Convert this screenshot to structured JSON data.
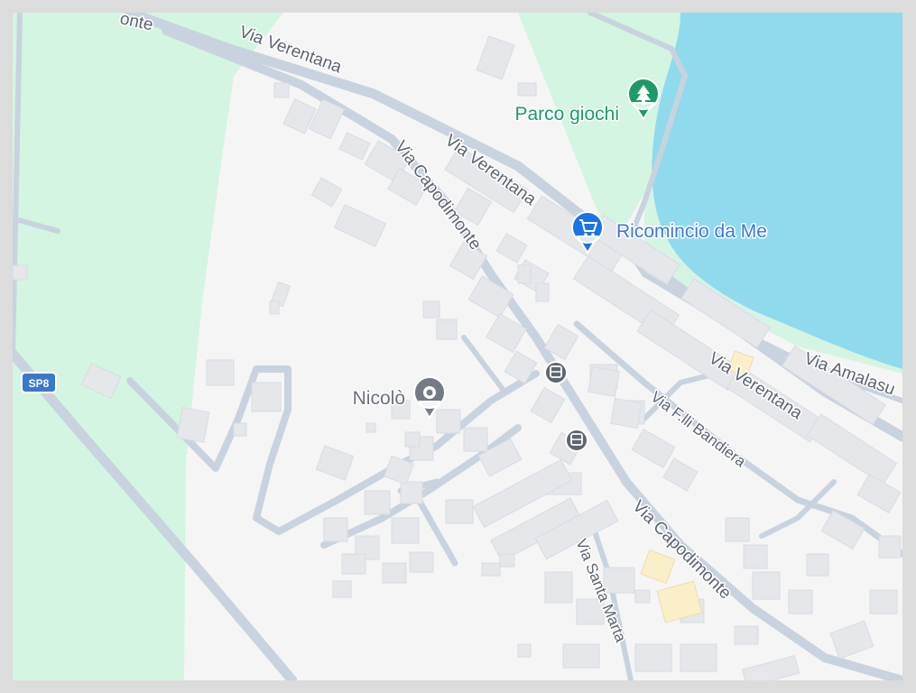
{
  "map": {
    "colors": {
      "land": "#f5f5f6",
      "park": "#d3f5e1",
      "water": "#90daee",
      "road": "#c9d3df",
      "building": "#e5e7ea",
      "highlight_building": "#fbefc9",
      "park_pin": "#1e9a6a",
      "shop_pin": "#1a73e8",
      "generic_pin": "#747b85",
      "shield": "#3c78c8"
    },
    "streets": {
      "via_verentana_top": "Via Verentana",
      "via_verentana_middle": "Via Verentana",
      "via_verentana_lower": "Via Verentana",
      "via_capodimonte_upper": "Via Capodimonte",
      "via_capodimonte_lower": "Via Capodimonte",
      "via_flli_bandiera": "Via F.lli Bandiera",
      "via_santa_marta": "Via Santa Marta",
      "via_amalasunta": "Via Amalasu",
      "corner_fragment": "onte"
    },
    "road_shield": "SP8",
    "pois": {
      "park": {
        "label": "Parco giochi",
        "icon": "tree-icon",
        "color": "#1e9a6a"
      },
      "shop": {
        "label": "Ricomincio da Me",
        "icon": "shopping-cart-icon",
        "color": "#3b78e0"
      },
      "place": {
        "label": "Nicolò",
        "icon": "place-pin-icon",
        "color": "#6b727c"
      }
    },
    "transit_stops": [
      {
        "icon": "bus-icon"
      },
      {
        "icon": "bus-icon"
      }
    ]
  }
}
